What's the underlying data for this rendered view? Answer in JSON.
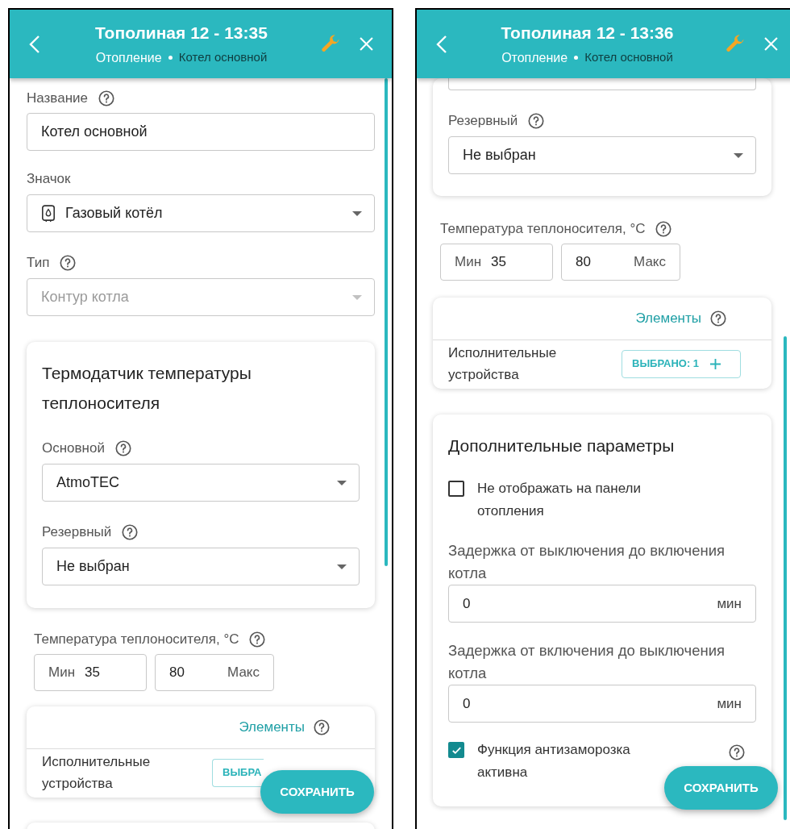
{
  "screens": [
    {
      "header": {
        "title": "Тополиная 12 - 13:35",
        "section": "Отопление",
        "device": "Котел основной"
      },
      "items": [
        {
          "kind": "text_field",
          "label": "Название",
          "help": true,
          "value": "Котел основной"
        },
        {
          "kind": "select",
          "label": "Значок",
          "help": false,
          "value": "Газовый котёл",
          "icon": true,
          "disabled": false
        },
        {
          "kind": "select",
          "label": "Тип",
          "help": true,
          "value": "Контур котла",
          "icon": false,
          "disabled": true
        },
        {
          "kind": "card",
          "title": "Термодатчик температуры теплоносителя",
          "clipped_top": false,
          "children": [
            {
              "kind": "select",
              "label": "Основной",
              "help": true,
              "value": "AtmoTEC",
              "icon": false,
              "disabled": false
            },
            {
              "kind": "select",
              "label": "Резервный",
              "help": true,
              "value": "Не выбран",
              "icon": false,
              "disabled": false
            }
          ]
        },
        {
          "kind": "range",
          "label": "Температура теплоносителя, °C",
          "help": true,
          "min_label": "Мин",
          "min_value": "35",
          "max_value": "80",
          "max_label": "Макс"
        },
        {
          "kind": "elements_card",
          "title": "Элементы",
          "row_label": "Исполнительные устройства",
          "button": "ВЫБРА",
          "plus": false
        },
        {
          "kind": "card_edge"
        }
      ],
      "save_button": "СОХРАНИТЬ"
    },
    {
      "header": {
        "title": "Тополиная 12 - 13:36",
        "section": "Отопление",
        "device": "Котел основной"
      },
      "items": [
        {
          "kind": "card",
          "clipped_top": true,
          "children": [
            {
              "kind": "select",
              "label": "Резервный",
              "help": true,
              "value": "Не выбран",
              "icon": false,
              "disabled": false
            }
          ]
        },
        {
          "kind": "range",
          "label": "Температура теплоносителя, °C",
          "help": true,
          "min_label": "Мин",
          "min_value": "35",
          "max_value": "80",
          "max_label": "Макс"
        },
        {
          "kind": "elements_card",
          "title": "Элементы",
          "row_label": "Исполнительные устройства",
          "button": "ВЫБРАНО: 1",
          "plus": true
        },
        {
          "kind": "card",
          "title": "Дополнительные параметры",
          "clipped_top": false,
          "children": [
            {
              "kind": "checkbox",
              "label": "Не отображать на панели отопления",
              "checked": false,
              "help": false
            },
            {
              "kind": "unit_field",
              "label": "Задержка от выключения до включения котла",
              "value": "0",
              "unit": "мин"
            },
            {
              "kind": "unit_field",
              "label": "Задержка от включения до выключения котла",
              "value": "0",
              "unit": "мин"
            },
            {
              "kind": "checkbox",
              "label": "Функция антизаморозка активна",
              "checked": true,
              "help": true
            }
          ]
        }
      ],
      "save_button": "СОХРАНИТЬ"
    }
  ]
}
